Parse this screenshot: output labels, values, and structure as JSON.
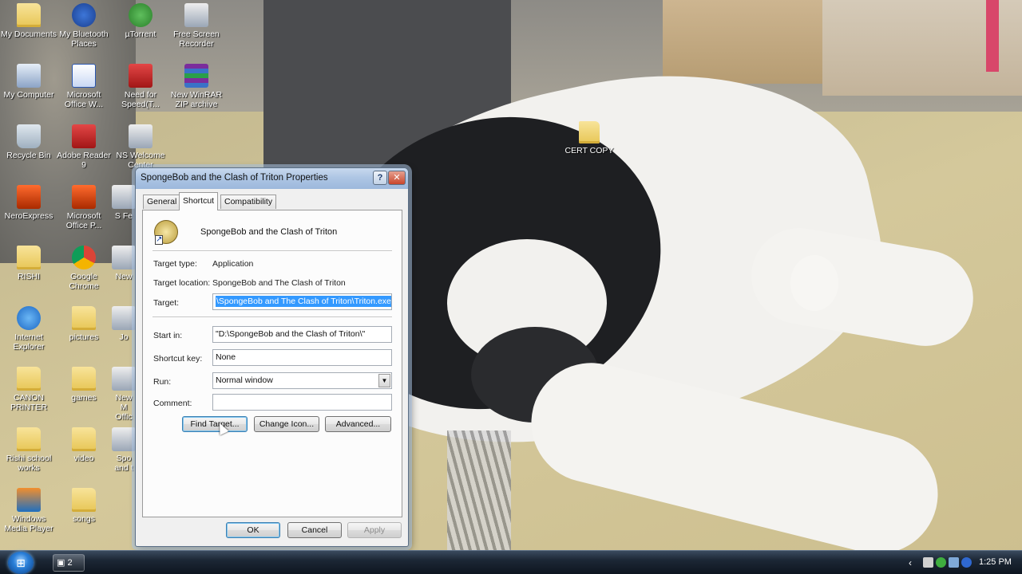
{
  "desktop": {
    "icons": [
      {
        "label": "My Documents",
        "icon": "folder-docs-icon"
      },
      {
        "label": "My Bluetooth Places",
        "icon": "bluetooth-icon"
      },
      {
        "label": "µTorrent",
        "icon": "utorrent-icon"
      },
      {
        "label": "Free Screen Recorder",
        "icon": "screen-recorder-icon"
      },
      {
        "label": "My Computer",
        "icon": "computer-icon"
      },
      {
        "label": "Microsoft Office W...",
        "icon": "word-icon"
      },
      {
        "label": "Need for Speed(T...",
        "icon": "game-icon"
      },
      {
        "label": "New WinRAR ZIP archive",
        "icon": "winrar-icon"
      },
      {
        "label": "Recycle Bin",
        "icon": "recycle-bin-icon"
      },
      {
        "label": "Adobe Reader 9",
        "icon": "adobe-reader-icon"
      },
      {
        "label": "NS Welcome Center",
        "icon": "shortcut-icon"
      },
      {
        "label": "NeroExpress",
        "icon": "nero-icon"
      },
      {
        "label": "Microsoft Office P...",
        "icon": "powerpoint-icon"
      },
      {
        "label": "S Fe",
        "icon": "shortcut-icon"
      },
      {
        "label": "RISHI",
        "icon": "folder-icon"
      },
      {
        "label": "Google Chrome",
        "icon": "chrome-icon"
      },
      {
        "label": "New",
        "icon": "shortcut-icon"
      },
      {
        "label": "Internet Explorer",
        "icon": "ie-icon"
      },
      {
        "label": "pictures",
        "icon": "folder-icon"
      },
      {
        "label": "Jo",
        "icon": "shortcut-icon"
      },
      {
        "label": "CANON PRINTER",
        "icon": "folder-icon"
      },
      {
        "label": "games",
        "icon": "folder-icon"
      },
      {
        "label": "New M Offic",
        "icon": "shortcut-icon"
      },
      {
        "label": "Rishi school works",
        "icon": "folder-icon"
      },
      {
        "label": "video",
        "icon": "folder-icon"
      },
      {
        "label": "Spo and t",
        "icon": "shortcut-icon"
      },
      {
        "label": "Windows Media Player",
        "icon": "media-player-icon"
      },
      {
        "label": "songs",
        "icon": "folder-icon"
      }
    ],
    "wallpaper_folder": {
      "label": "CERT COPY",
      "icon": "folder-icon"
    }
  },
  "dialog": {
    "title": "SpongeBob and the Clash of Triton Properties",
    "help_glyph": "?",
    "close_glyph": "✕",
    "tabs": [
      {
        "label": "General",
        "active": false
      },
      {
        "label": "Shortcut",
        "active": true
      },
      {
        "label": "Compatibility",
        "active": false
      }
    ],
    "shortcut_name": "SpongeBob and the Clash of Triton",
    "labels": {
      "target_type": "Target type:",
      "target_location": "Target location:",
      "target": "Target:",
      "start_in": "Start in:",
      "shortcut_key": "Shortcut key:",
      "run": "Run:",
      "comment": "Comment:"
    },
    "values": {
      "target_type": "Application",
      "target_location": "SpongeBob and The Clash of Triton",
      "target": "\\SpongeBob and The Clash of Triton\\Triton.exe\"",
      "start_in": "\"D:\\SpongeBob and the Clash of Triton\\\"",
      "shortcut_key": "None",
      "run": "Normal window",
      "comment": ""
    },
    "buttons": {
      "find_target": "Find Target...",
      "change_icon": "Change Icon...",
      "advanced": "Advanced...",
      "ok": "OK",
      "cancel": "Cancel",
      "apply": "Apply"
    }
  },
  "taskbar": {
    "start_glyph": "⊞",
    "group_label": "2",
    "tray_chevron": "‹",
    "clock": "1:25 PM"
  },
  "colors": {
    "selection": "#3399ff",
    "titlebar": "#aec6e4",
    "taskbar": "#1c2735"
  }
}
